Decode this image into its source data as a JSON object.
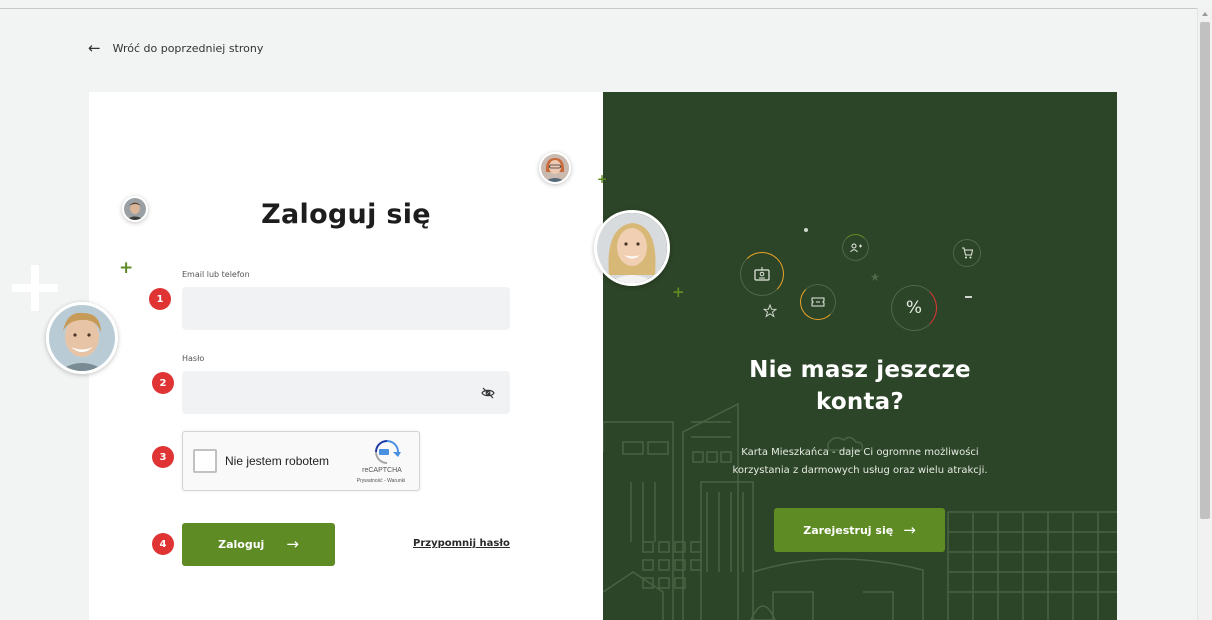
{
  "nav": {
    "back_label": "Wróć do poprzedniej strony"
  },
  "login": {
    "title": "Zaloguj się",
    "email_label": "Email lub telefon",
    "email_value": "",
    "password_label": "Hasło",
    "password_value": "",
    "steps": [
      "1",
      "2",
      "3",
      "4"
    ],
    "recaptcha": {
      "label": "Nie jestem robotem",
      "brand": "reCAPTCHA",
      "links": "Prywatność - Warunki"
    },
    "submit_label": "Zaloguj",
    "forgot_label": "Przypomnij hasło"
  },
  "register": {
    "title_line1": "Nie masz jeszcze",
    "title_line2": "konta?",
    "description_line1": "Karta Mieszkańca - daje Ci ogromne możliwości",
    "description_line2": "korzystania z darmowych usług oraz wielu atrakcji.",
    "button_label": "Zarejestruj się",
    "percent_symbol": "%"
  },
  "colors": {
    "brand_green": "#5f8b25",
    "panel_dark_green": "#2c4427",
    "step_red": "#e03434",
    "accent_orange": "#e8a22a"
  }
}
